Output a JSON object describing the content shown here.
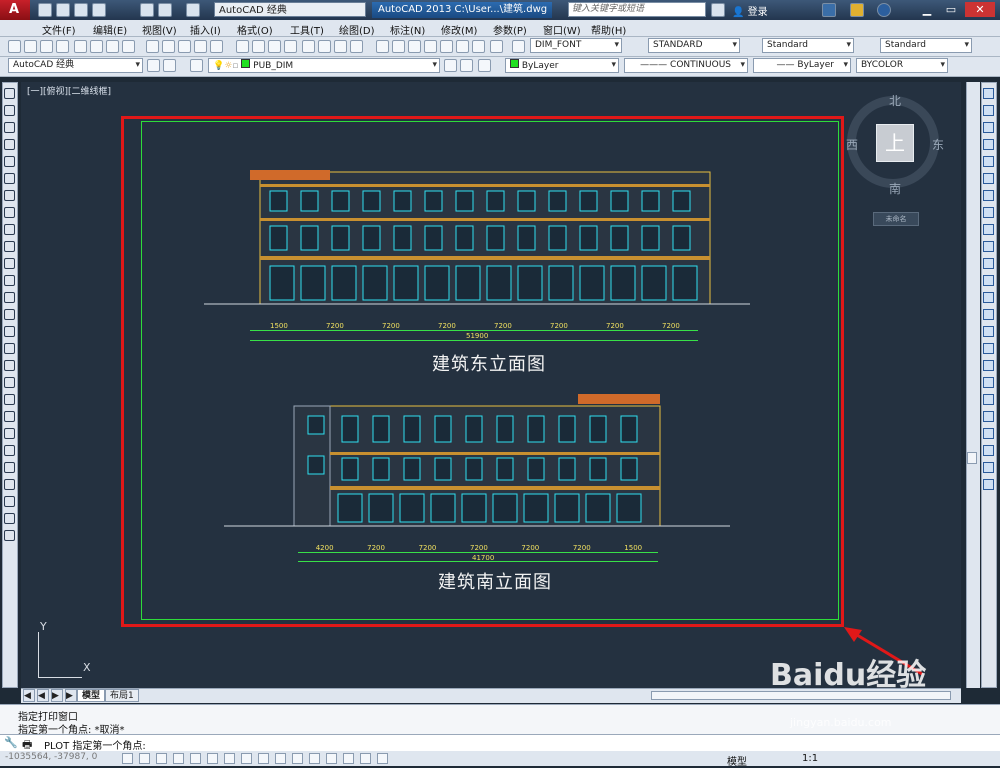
{
  "titlebar": {
    "workspace": "AutoCAD 经典",
    "title": "AutoCAD 2013    C:\\User...\\建筑.dwg",
    "search_placeholder": "键入关键字或短语",
    "login": "登录"
  },
  "menus": [
    "文件(F)",
    "编辑(E)",
    "视图(V)",
    "插入(I)",
    "格式(O)",
    "工具(T)",
    "绘图(D)",
    "标注(N)",
    "修改(M)",
    "参数(P)",
    "窗口(W)",
    "帮助(H)"
  ],
  "styles": {
    "text_style": "DIM_FONT",
    "dim_style": "STANDARD",
    "table_style": "Standard",
    "multileader_style": "Standard"
  },
  "layers": {
    "workspace": "AutoCAD 经典",
    "current_layer": "PUB_DIM",
    "color": "ByLayer",
    "linetype": "CONTINUOUS",
    "lineweight": "ByLayer",
    "plotstyle": "BYCOLOR"
  },
  "viewport": {
    "label": "[一][俯视][二维线框]"
  },
  "drawing": {
    "east_caption": "建筑东立面图",
    "south_caption": "建筑南立面图",
    "east_dims": [
      "1500",
      "7200",
      "7200",
      "7200",
      "7200",
      "7200",
      "7200",
      "7200"
    ],
    "east_total": "51900",
    "south_dims": [
      "4200",
      "7200",
      "7200",
      "7200",
      "7200",
      "7200",
      "1500"
    ],
    "south_total": "41700"
  },
  "viewcube": {
    "north": "北",
    "south": "南",
    "east": "东",
    "west": "西",
    "top": "上",
    "wcs": "未命名"
  },
  "ucs": {
    "x": "X",
    "y": "Y"
  },
  "tabs": {
    "model": "模型",
    "layout": "布局1"
  },
  "command": {
    "line1": "指定打印窗口",
    "line2": "指定第一个角点: *取消*",
    "prompt": "PLOT 指定第一个角点:"
  },
  "status": {
    "coords": "-1035564, -37987, 0",
    "model": "模型",
    "scale": "1:1"
  },
  "watermark": {
    "brand": "Baidu经验",
    "url": "jingyan.baidu.com"
  },
  "colors": {
    "accent_red": "#e01818",
    "margin_green": "#2edc3a",
    "window_cyan": "#30e0f0",
    "wall_yellow": "#e8c040",
    "roof_orange": "#d06a2a"
  }
}
